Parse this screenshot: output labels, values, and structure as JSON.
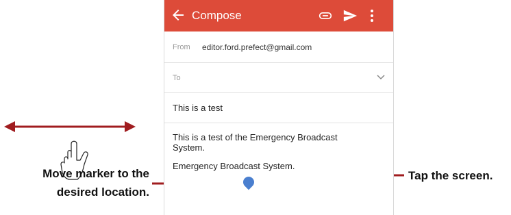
{
  "appbar": {
    "title": "Compose",
    "icons": [
      "back-arrow-icon",
      "paperclip-icon",
      "send-icon",
      "more-vert-icon"
    ],
    "color": "#dd4b39"
  },
  "from": {
    "label": "From",
    "value": "editor.ford.prefect@gmail.com"
  },
  "to": {
    "label": "To",
    "value": ""
  },
  "subject": {
    "value": "This is a test"
  },
  "body": {
    "line1": "This is a test of the Emergency Broadcast System.",
    "line2": "Emergency Broadcast System."
  },
  "callouts": {
    "left": "Move marker to the desired location.",
    "right": "Tap the screen.",
    "accent": "#a01c1f"
  }
}
